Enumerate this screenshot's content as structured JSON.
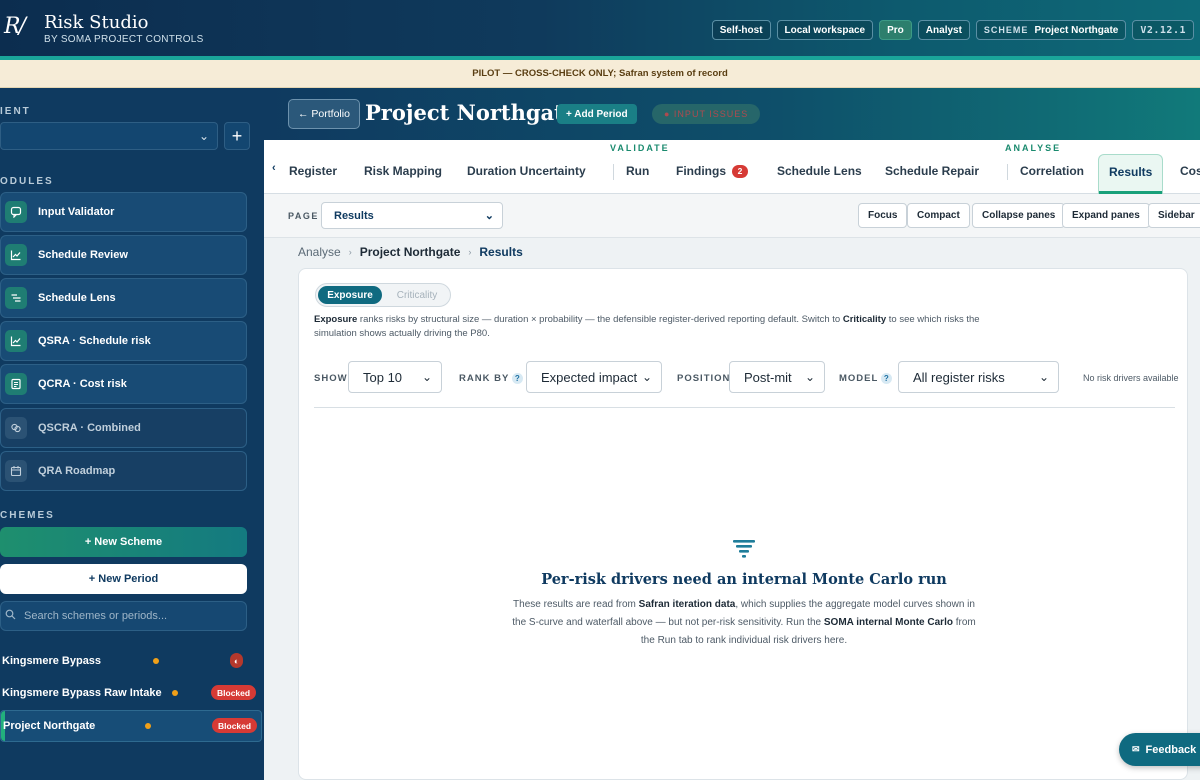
{
  "app": {
    "logo": "R/",
    "name": "Risk Studio",
    "subtitle": "BY SOMA PROJECT CONTROLS"
  },
  "header_pills": {
    "selfhost": "Self-host",
    "workspace": "Local workspace",
    "pro": "Pro",
    "role": "Analyst",
    "scheme_key": "SCHEME",
    "scheme_value": "Project Northgate",
    "version": "V2.12.1"
  },
  "banner": "PILOT — CROSS-CHECK ONLY; Safran system of record",
  "sidebar": {
    "client_label": "IENT",
    "client_value": "",
    "modules_label": "ODULES",
    "modules": [
      {
        "label": "Input Validator",
        "icon": "chat-icon"
      },
      {
        "label": "Schedule Review",
        "icon": "chart-icon"
      },
      {
        "label": "Schedule Lens",
        "icon": "lines-icon"
      },
      {
        "label": "QSRA · Schedule risk",
        "icon": "chart-icon"
      },
      {
        "label": "QCRA · Cost risk",
        "icon": "doc-icon"
      },
      {
        "label": "QSCRA · Combined",
        "icon": "link-icon"
      },
      {
        "label": "QRA Roadmap",
        "icon": "calendar-icon"
      }
    ],
    "schemes_label": "CHEMES",
    "new_scheme": "+ New Scheme",
    "new_period": "+ New Period",
    "search_placeholder": "Search schemes or periods...",
    "schemes": [
      {
        "name": "Kingsmere Bypass",
        "badge": "◐"
      },
      {
        "name": "Kingsmere Bypass Raw Intake",
        "badge": "Blocked"
      },
      {
        "name": "Project Northgate",
        "badge": "Blocked"
      }
    ]
  },
  "project": {
    "portfolio_btn": "← Portfolio",
    "title": "Project Northgate",
    "add_period": "+ Add Period",
    "input_issues": "● INPUT ISSUES"
  },
  "tabs": {
    "group_validate": "VALIDATE",
    "group_analyse": "ANALYSE",
    "items": [
      "Register",
      "Risk Mapping",
      "Duration Uncertainty",
      "Run",
      "Findings",
      "Schedule Lens",
      "Schedule Repair",
      "Correlation",
      "Results",
      "Cos"
    ],
    "findings_badge": "2"
  },
  "pagebar": {
    "label": "PAGE",
    "select_value": "Results",
    "buttons": [
      "Focus",
      "Compact",
      "Collapse panes",
      "Expand panes",
      "Sidebar"
    ]
  },
  "breadcrumb": [
    "Analyse",
    "Project Northgate",
    "Results"
  ],
  "results": {
    "toggle_on": "Exposure",
    "toggle_off": "Criticality",
    "desc_b1": "Exposure",
    "desc_t1": " ranks risks by structural size — duration × probability — the defensible register-derived reporting default. Switch to ",
    "desc_b2": "Criticality",
    "desc_t2": " to see which risks the simulation shows actually driving the P80.",
    "controls": {
      "show_label": "SHOW",
      "show_value": "Top 10",
      "rank_label": "RANK BY",
      "rank_value": "Expected impact",
      "position_label": "POSITION",
      "position_value": "Post-mit",
      "model_label": "MODEL",
      "model_value": "All register risks",
      "no_drivers": "No risk drivers available"
    },
    "empty_title": "Per-risk drivers need an internal Monte Carlo run",
    "empty_t1": "These results are read from ",
    "empty_b1": "Safran iteration data",
    "empty_t2": ", which supplies the aggregate model curves shown in the S-curve and waterfall above — but not per-risk sensitivity. Run the ",
    "empty_b2": "SOMA internal Monte Carlo",
    "empty_t3": " from the Run tab to rank individual risk drivers here."
  },
  "feedback": "Feedback",
  "colors": {
    "navy": "#0f3a60",
    "teal": "#1aa59a",
    "danger": "#d63a35",
    "warn": "#f0a019"
  }
}
